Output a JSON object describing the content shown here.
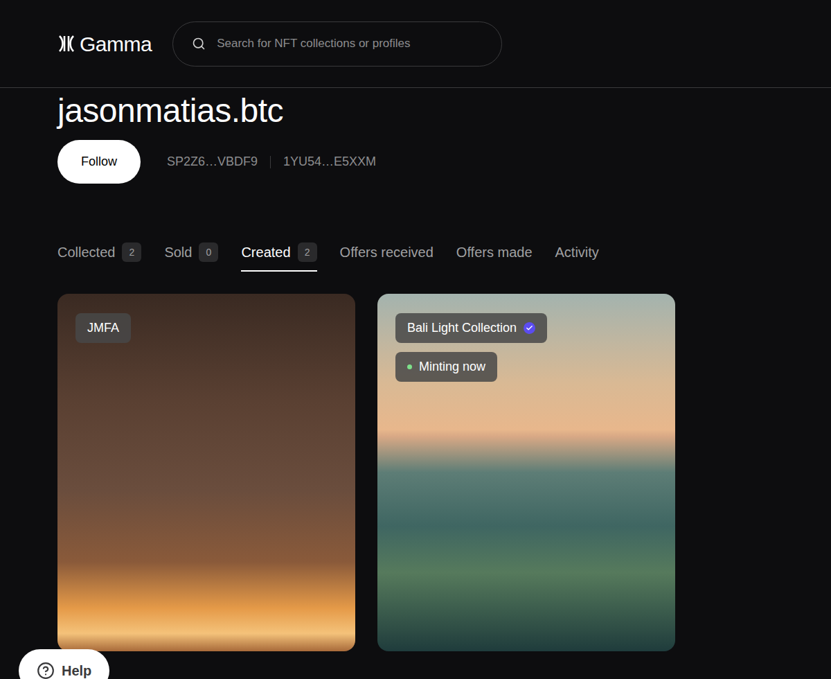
{
  "header": {
    "logo": "Gamma",
    "search": {
      "placeholder": "Search for NFT collections or profiles"
    }
  },
  "profile": {
    "name": "jasonmatias.btc",
    "follow_button": "Follow",
    "addresses": [
      "SP2Z6…VBDF9",
      "1YU54…E5XXM"
    ]
  },
  "tabs": [
    {
      "label": "Collected",
      "count": "2",
      "selected": false
    },
    {
      "label": "Sold",
      "count": "0",
      "selected": false
    },
    {
      "label": "Created",
      "count": "2",
      "selected": true
    },
    {
      "label": "Offers received",
      "selected": false
    },
    {
      "label": "Offers made",
      "selected": false
    },
    {
      "label": "Activity",
      "selected": false
    }
  ],
  "cards": [
    {
      "badges": [
        {
          "label": "JMFA",
          "kind": "plain"
        }
      ]
    },
    {
      "badges": [
        {
          "label": "Bali Light Collection",
          "kind": "verified"
        },
        {
          "label": "Minting now",
          "kind": "status"
        }
      ]
    }
  ],
  "help_button": {
    "label": "Help"
  }
}
